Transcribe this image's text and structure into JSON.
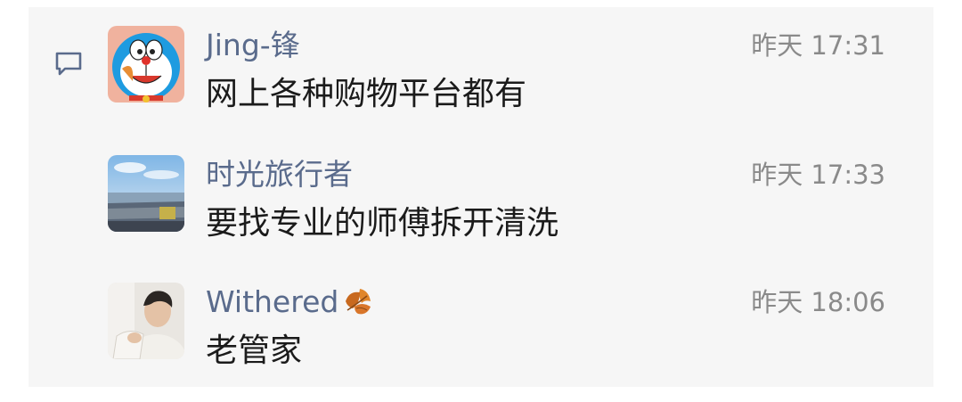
{
  "comments": [
    {
      "name": "Jing-锋",
      "time": "昨天 17:31",
      "message": "网上各种购物平台都有",
      "avatar": "doraemon-avatar"
    },
    {
      "name": "时光旅行者",
      "time": "昨天 17:33",
      "message": "要找专业的师傅拆开清洗",
      "avatar": "seaside-photo-avatar"
    },
    {
      "name": "Withered",
      "time": "昨天 18:06",
      "message": "老管家",
      "avatar": "person-photo-avatar",
      "name_emoji": "fallen-leaf-icon"
    }
  ],
  "icons": {
    "comment": "comment-bubble-icon"
  },
  "colors": {
    "name": "#5a6b8c",
    "time": "#8a8a8a",
    "message": "#1b1b1b",
    "panel_bg": "#f6f6f6"
  }
}
